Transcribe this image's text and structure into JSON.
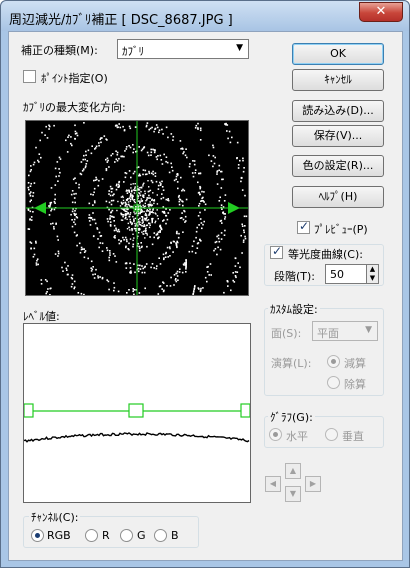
{
  "window": {
    "title": "周辺減光/ｶﾌﾞﾘ補正 [ DSC_8687.JPG ]",
    "close_glyph": "✕"
  },
  "correction_type": {
    "label": "補正の種類(M):",
    "value": "ｶﾌﾞﾘ"
  },
  "point_specify": {
    "label": "ﾎﾟｲﾝﾄ指定(O)",
    "checked": false
  },
  "max_change_direction": {
    "label": "ｶﾌﾞﾘの最大変化方向:"
  },
  "level_value": {
    "label": "ﾚﾍﾞﾙ値:"
  },
  "channel": {
    "title": "ﾁｬﾝﾈﾙ(C):",
    "options": [
      {
        "label": "RGB",
        "checked": true
      },
      {
        "label": "R",
        "checked": false
      },
      {
        "label": "G",
        "checked": false
      },
      {
        "label": "B",
        "checked": false
      }
    ]
  },
  "buttons": {
    "ok": "OK",
    "cancel": "ｷｬﾝｾﾙ",
    "load": "読み込み(D)...",
    "save": "保存(V)...",
    "color_setting": "色の設定(R)...",
    "help": "ﾍﾙﾌﾟ(H)"
  },
  "preview": {
    "label": "ﾌﾟﾚﾋﾞｭｰ(P)",
    "checked": true
  },
  "contour": {
    "label": "等光度曲線(C):",
    "checked": true,
    "step_label": "段階(T):",
    "step_value": "50"
  },
  "custom": {
    "title": "ｶｽﾀﾑ設定:",
    "surface_label": "面(S):",
    "surface_value": "平面",
    "operation_label": "演算(L):",
    "operations": [
      {
        "label": "減算",
        "checked": true
      },
      {
        "label": "除算",
        "checked": false
      }
    ]
  },
  "graph": {
    "title": "ｸﾞﾗﾌ(G):",
    "options": [
      {
        "label": "水平",
        "checked": true
      },
      {
        "label": "垂直",
        "checked": false
      }
    ]
  },
  "nav_icons": {
    "up": "▲",
    "down": "▼",
    "left": "◀",
    "right": "▶"
  },
  "colors": {
    "guide_line": "#22cc22",
    "preview_bg": "#000000",
    "points": "#ffffff"
  }
}
